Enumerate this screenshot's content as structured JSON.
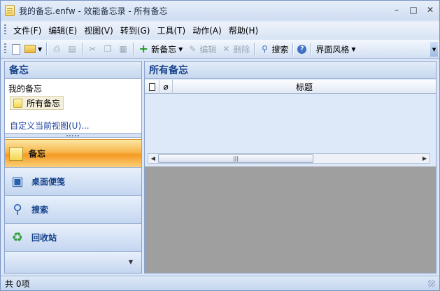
{
  "window": {
    "title": "我的备忘.enfw - 效能备忘录 - 所有备忘",
    "minimize": "–",
    "maximize": "□",
    "close": "✕"
  },
  "menu": [
    "文件(F)",
    "编辑(E)",
    "视图(V)",
    "转到(G)",
    "工具(T)",
    "动作(A)",
    "帮助(H)"
  ],
  "toolbar": {
    "new_memo": "新备忘",
    "edit": "编辑",
    "delete": "删除",
    "search": "搜索",
    "theme": "界面风格"
  },
  "left_panel": {
    "title": "备忘",
    "tree_root": "我的备忘",
    "tree_selected": "所有备忘",
    "custom_view": "自定义当前视图(U)...",
    "nav": {
      "notes": "备忘",
      "sticky": "桌面便笺",
      "search": "搜索",
      "recycle": "回收站"
    }
  },
  "right_panel": {
    "title": "所有备忘",
    "col_title": "标题"
  },
  "status": {
    "count": "共 0项"
  },
  "icons": [
    "note-icon",
    "open-folder-icon",
    "print-icon",
    "print-preview-icon",
    "cut-icon",
    "copy-icon",
    "paste-icon",
    "add-icon",
    "edit-icon",
    "delete-icon",
    "search-icon",
    "help-icon",
    "document-icon",
    "paperclip-icon",
    "sticky-note-icon",
    "magnifier-icon",
    "recycle-icon"
  ],
  "colors": {
    "accent_orange": "#f7b64a",
    "header_blue": "#15428b",
    "pane_gray": "#9f9f9f"
  }
}
